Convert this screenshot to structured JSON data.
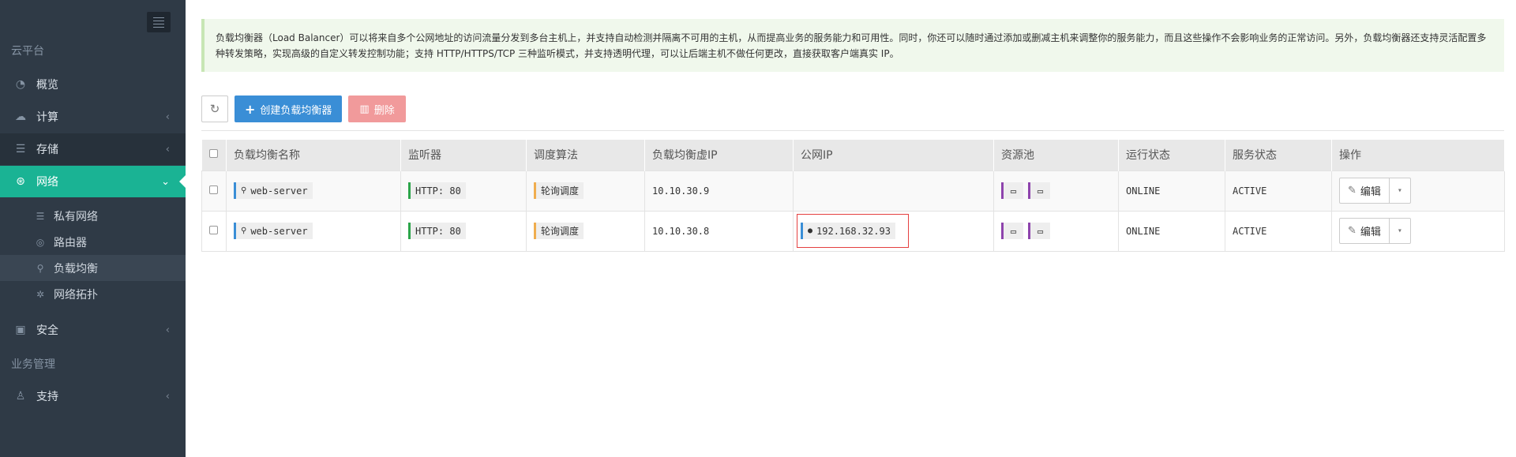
{
  "sidebar": {
    "header_cloud": "云平台",
    "header_business": "业务管理",
    "items": {
      "overview": {
        "label": "概览",
        "icon": "dashboard-icon"
      },
      "compute": {
        "label": "计算",
        "icon": "cloud-icon"
      },
      "storage": {
        "label": "存储",
        "icon": "database-icon"
      },
      "network": {
        "label": "网络",
        "icon": "network-icon"
      },
      "security": {
        "label": "安全",
        "icon": "briefcase-icon"
      },
      "support": {
        "label": "支持",
        "icon": "support-icon"
      }
    },
    "network_sub": {
      "private": "私有网络",
      "router": "路由器",
      "lb": "负载均衡",
      "topology": "网络拓扑"
    },
    "active_color": "#1ab394"
  },
  "notice": "负载均衡器（Load Balancer）可以将来自多个公网地址的访问流量分发到多台主机上，并支持自动检测并隔离不可用的主机，从而提高业务的服务能力和可用性。同时，你还可以随时通过添加或删减主机来调整你的服务能力，而且这些操作不会影响业务的正常访问。另外，负载均衡器还支持灵活配置多种转发策略，实现高级的自定义转发控制功能；支持 HTTP/HTTPS/TCP 三种监听模式，并支持透明代理，可以让后端主机不做任何更改，直接获取客户端真实 IP。",
  "toolbar": {
    "create_label": "创建负载均衡器",
    "delete_label": "删除"
  },
  "table": {
    "headers": {
      "name": "负载均衡名称",
      "listener": "监听器",
      "algorithm": "调度算法",
      "vip": "负载均衡虚IP",
      "public_ip": "公网IP",
      "pool": "资源池",
      "run_status": "运行状态",
      "service_status": "服务状态",
      "action": "操作"
    },
    "rows": [
      {
        "name": "web-server",
        "listener": "HTTP: 80",
        "algorithm": "轮询调度",
        "vip": "10.10.30.9",
        "public_ip": "",
        "run_status": "ONLINE",
        "service_status": "ACTIVE",
        "edit": "编辑"
      },
      {
        "name": "web-server",
        "listener": "HTTP: 80",
        "algorithm": "轮询调度",
        "vip": "10.10.30.8",
        "public_ip": "192.168.32.93",
        "run_status": "ONLINE",
        "service_status": "ACTIVE",
        "edit": "编辑"
      }
    ]
  }
}
